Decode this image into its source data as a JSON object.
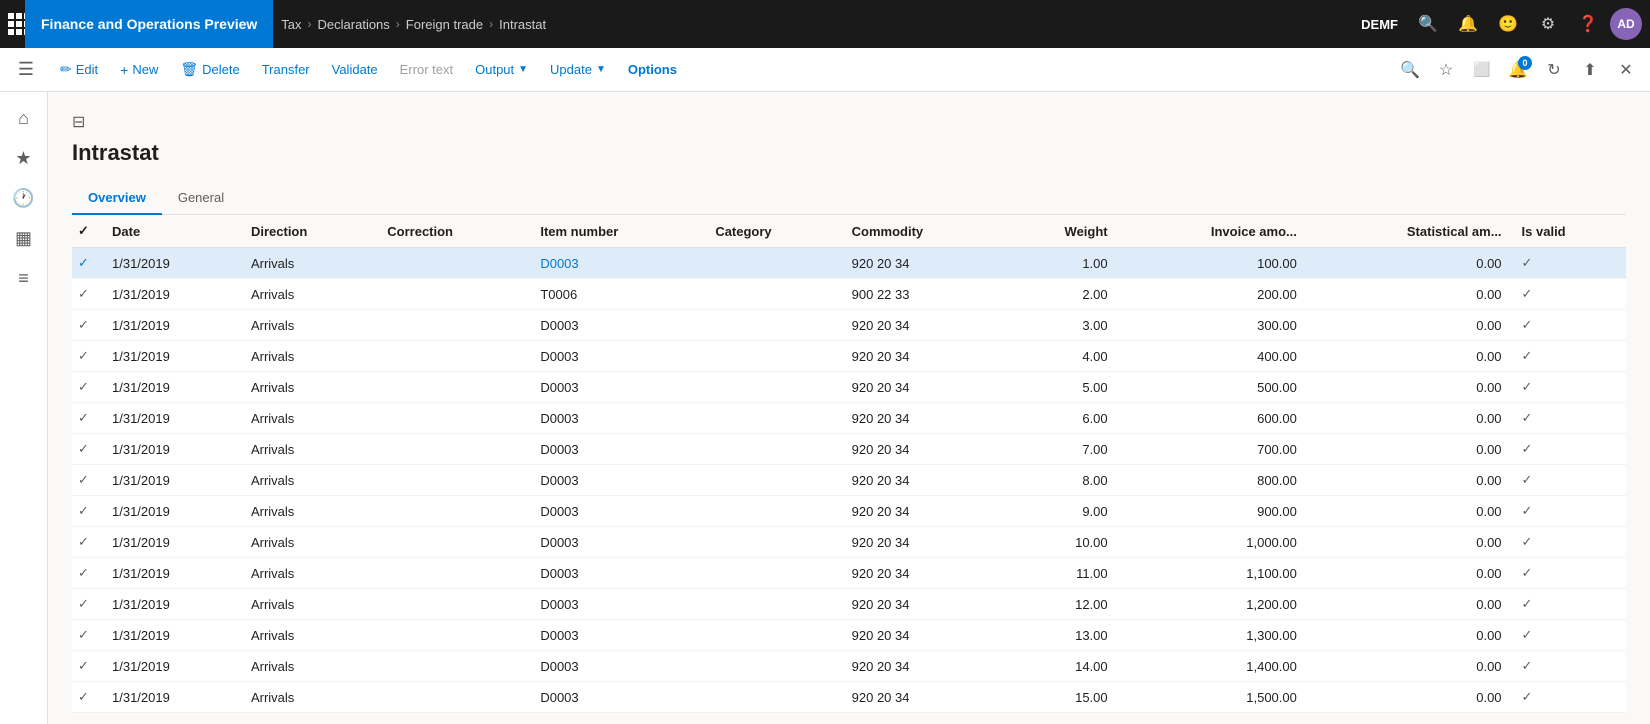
{
  "topbar": {
    "app_title": "Finance and Operations Preview",
    "breadcrumbs": [
      "Tax",
      "Declarations",
      "Foreign trade",
      "Intrastat"
    ],
    "company": "DEMF",
    "avatar_initials": "AD",
    "notification_count": "0"
  },
  "actionbar": {
    "edit_label": "Edit",
    "new_label": "New",
    "delete_label": "Delete",
    "transfer_label": "Transfer",
    "validate_label": "Validate",
    "error_text_label": "Error text",
    "output_label": "Output",
    "update_label": "Update",
    "options_label": "Options"
  },
  "page": {
    "title": "Intrastat"
  },
  "tabs": [
    {
      "label": "Overview",
      "active": true
    },
    {
      "label": "General",
      "active": false
    }
  ],
  "table": {
    "columns": [
      "",
      "Date",
      "Direction",
      "Correction",
      "Item number",
      "Category",
      "Commodity",
      "Weight",
      "Invoice amo...",
      "Statistical am...",
      "Is valid"
    ],
    "rows": [
      {
        "selected": true,
        "date": "1/31/2019",
        "direction": "Arrivals",
        "correction": "",
        "item_number": "D0003",
        "category": "",
        "commodity": "920 20 34",
        "weight": "1.00",
        "invoice": "100.00",
        "statistical": "0.00",
        "is_valid": true
      },
      {
        "selected": false,
        "date": "1/31/2019",
        "direction": "Arrivals",
        "correction": "",
        "item_number": "T0006",
        "category": "",
        "commodity": "900 22 33",
        "weight": "2.00",
        "invoice": "200.00",
        "statistical": "0.00",
        "is_valid": true
      },
      {
        "selected": false,
        "date": "1/31/2019",
        "direction": "Arrivals",
        "correction": "",
        "item_number": "D0003",
        "category": "",
        "commodity": "920 20 34",
        "weight": "3.00",
        "invoice": "300.00",
        "statistical": "0.00",
        "is_valid": true
      },
      {
        "selected": false,
        "date": "1/31/2019",
        "direction": "Arrivals",
        "correction": "",
        "item_number": "D0003",
        "category": "",
        "commodity": "920 20 34",
        "weight": "4.00",
        "invoice": "400.00",
        "statistical": "0.00",
        "is_valid": true
      },
      {
        "selected": false,
        "date": "1/31/2019",
        "direction": "Arrivals",
        "correction": "",
        "item_number": "D0003",
        "category": "",
        "commodity": "920 20 34",
        "weight": "5.00",
        "invoice": "500.00",
        "statistical": "0.00",
        "is_valid": true
      },
      {
        "selected": false,
        "date": "1/31/2019",
        "direction": "Arrivals",
        "correction": "",
        "item_number": "D0003",
        "category": "",
        "commodity": "920 20 34",
        "weight": "6.00",
        "invoice": "600.00",
        "statistical": "0.00",
        "is_valid": true
      },
      {
        "selected": false,
        "date": "1/31/2019",
        "direction": "Arrivals",
        "correction": "",
        "item_number": "D0003",
        "category": "",
        "commodity": "920 20 34",
        "weight": "7.00",
        "invoice": "700.00",
        "statistical": "0.00",
        "is_valid": true
      },
      {
        "selected": false,
        "date": "1/31/2019",
        "direction": "Arrivals",
        "correction": "",
        "item_number": "D0003",
        "category": "",
        "commodity": "920 20 34",
        "weight": "8.00",
        "invoice": "800.00",
        "statistical": "0.00",
        "is_valid": true
      },
      {
        "selected": false,
        "date": "1/31/2019",
        "direction": "Arrivals",
        "correction": "",
        "item_number": "D0003",
        "category": "",
        "commodity": "920 20 34",
        "weight": "9.00",
        "invoice": "900.00",
        "statistical": "0.00",
        "is_valid": true
      },
      {
        "selected": false,
        "date": "1/31/2019",
        "direction": "Arrivals",
        "correction": "",
        "item_number": "D0003",
        "category": "",
        "commodity": "920 20 34",
        "weight": "10.00",
        "invoice": "1,000.00",
        "statistical": "0.00",
        "is_valid": true
      },
      {
        "selected": false,
        "date": "1/31/2019",
        "direction": "Arrivals",
        "correction": "",
        "item_number": "D0003",
        "category": "",
        "commodity": "920 20 34",
        "weight": "11.00",
        "invoice": "1,100.00",
        "statistical": "0.00",
        "is_valid": true
      },
      {
        "selected": false,
        "date": "1/31/2019",
        "direction": "Arrivals",
        "correction": "",
        "item_number": "D0003",
        "category": "",
        "commodity": "920 20 34",
        "weight": "12.00",
        "invoice": "1,200.00",
        "statistical": "0.00",
        "is_valid": true
      },
      {
        "selected": false,
        "date": "1/31/2019",
        "direction": "Arrivals",
        "correction": "",
        "item_number": "D0003",
        "category": "",
        "commodity": "920 20 34",
        "weight": "13.00",
        "invoice": "1,300.00",
        "statistical": "0.00",
        "is_valid": true
      },
      {
        "selected": false,
        "date": "1/31/2019",
        "direction": "Arrivals",
        "correction": "",
        "item_number": "D0003",
        "category": "",
        "commodity": "920 20 34",
        "weight": "14.00",
        "invoice": "1,400.00",
        "statistical": "0.00",
        "is_valid": true
      },
      {
        "selected": false,
        "date": "1/31/2019",
        "direction": "Arrivals",
        "correction": "",
        "item_number": "D0003",
        "category": "",
        "commodity": "920 20 34",
        "weight": "15.00",
        "invoice": "1,500.00",
        "statistical": "0.00",
        "is_valid": true
      }
    ]
  }
}
